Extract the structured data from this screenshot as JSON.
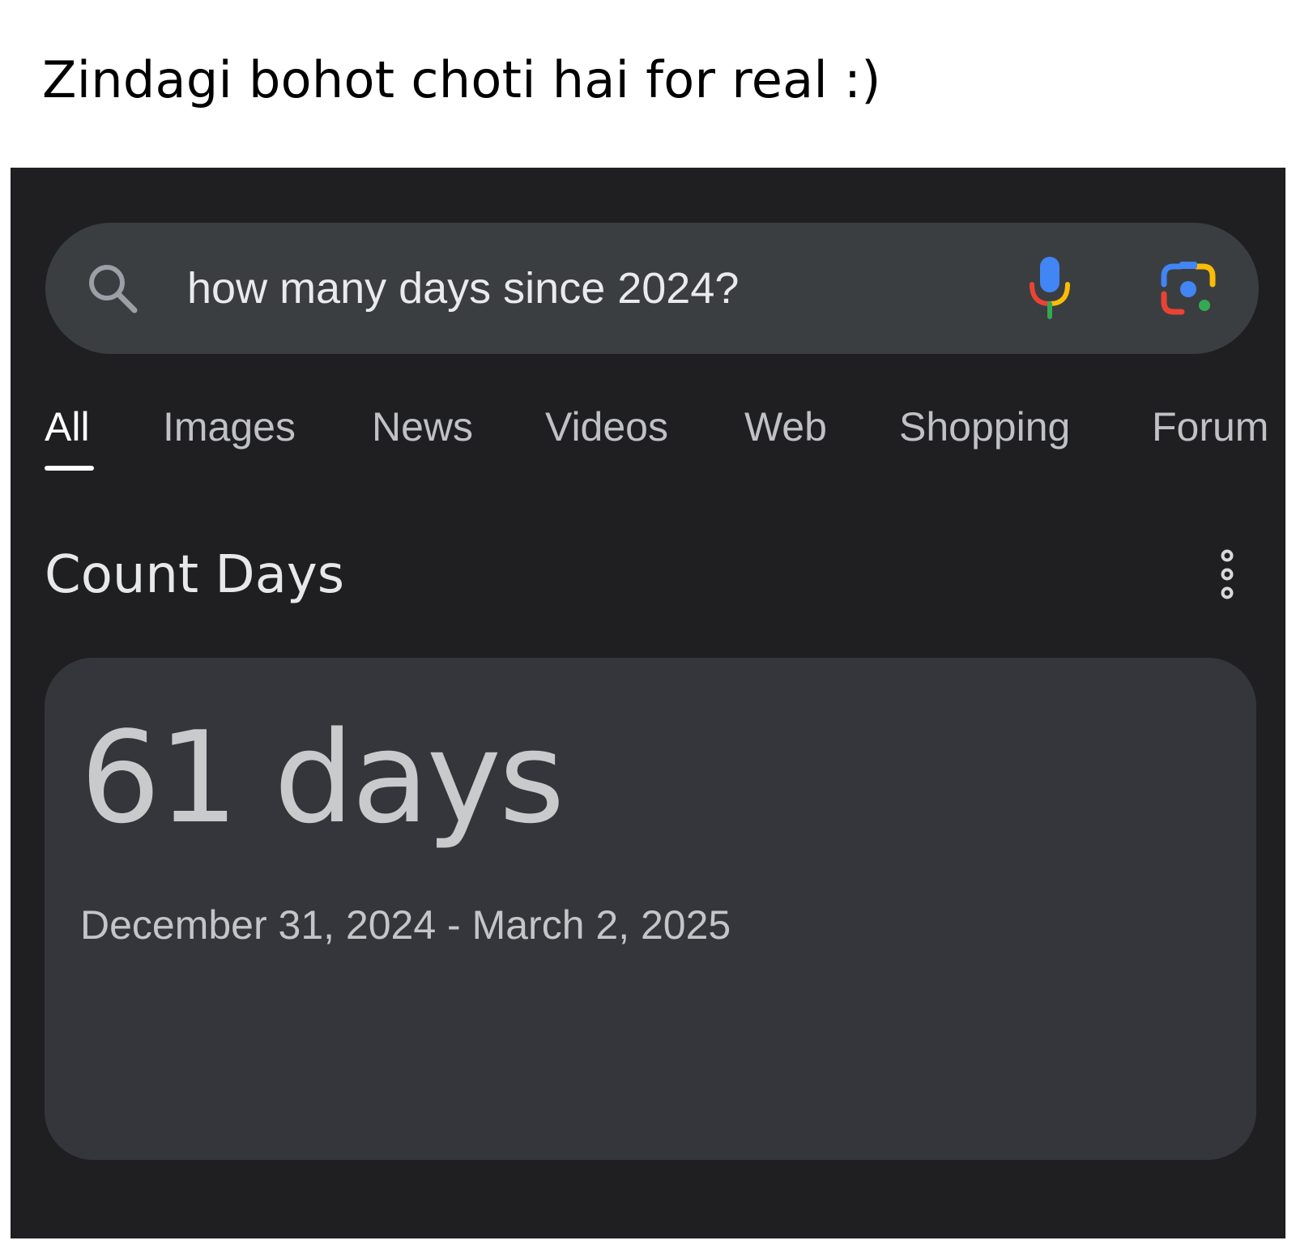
{
  "caption": "Zindagi bohot choti hai for real :)",
  "search": {
    "query": "how many days since 2024?"
  },
  "tabs": [
    {
      "label": "All",
      "active": true
    },
    {
      "label": "Images",
      "active": false
    },
    {
      "label": "News",
      "active": false
    },
    {
      "label": "Videos",
      "active": false
    },
    {
      "label": "Web",
      "active": false
    },
    {
      "label": "Shopping",
      "active": false
    },
    {
      "label": "Forum",
      "active": false
    }
  ],
  "section": {
    "title": "Count Days"
  },
  "result": {
    "value": "61 days",
    "range": "December 31, 2024 - March 2, 2025"
  },
  "icons": {
    "search": "search-icon",
    "mic": "microphone-icon",
    "lens": "lens-camera-icon",
    "more": "more-vertical-icon"
  },
  "colors": {
    "background": "#1f1f21",
    "search_bar": "#3a3e40",
    "card": "#35363b",
    "google_blue": "#4285f4",
    "google_red": "#ea4335",
    "google_yellow": "#fbbc05",
    "google_green": "#34a853"
  }
}
